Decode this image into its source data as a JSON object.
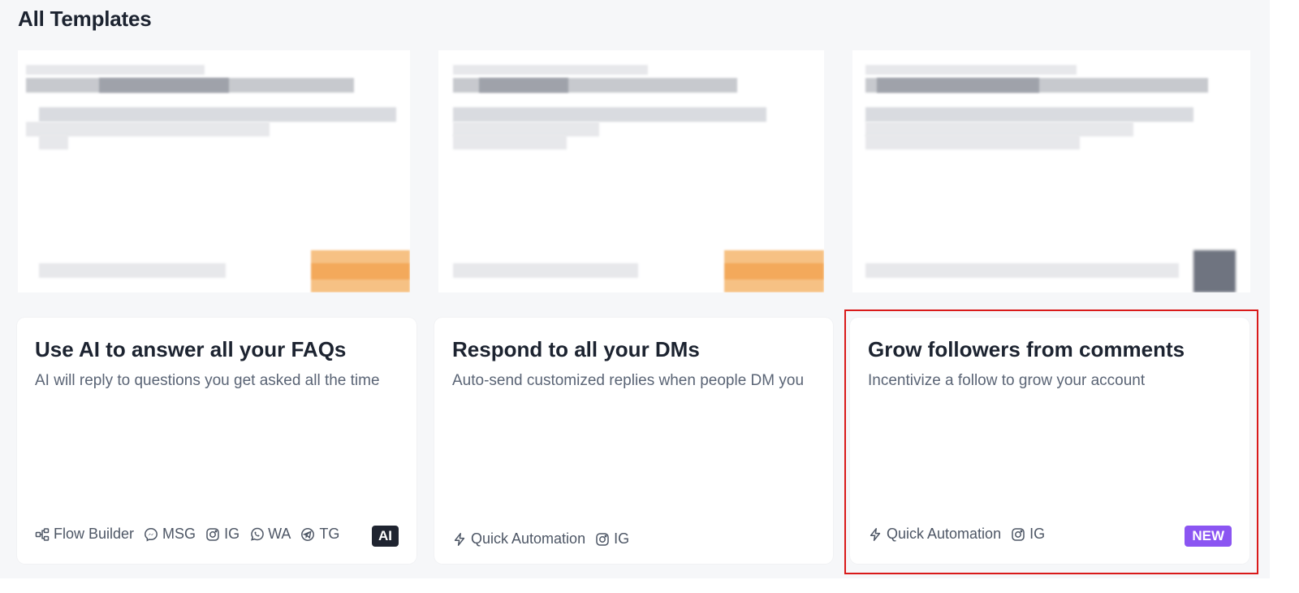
{
  "page": {
    "title": "All Templates"
  },
  "templates": [
    {
      "title": "Use AI to answer all your FAQs",
      "description": "AI will reply to questions you get asked all the time",
      "meta": [
        {
          "icon": "flow-builder-icon",
          "label": "Flow Builder"
        },
        {
          "icon": "messenger-icon",
          "label": "MSG"
        },
        {
          "icon": "instagram-icon",
          "label": "IG"
        },
        {
          "icon": "whatsapp-icon",
          "label": "WA"
        },
        {
          "icon": "telegram-icon",
          "label": "TG"
        }
      ],
      "tag": "AI"
    },
    {
      "title": "Respond to all your DMs",
      "description": "Auto-send customized replies when people DM you",
      "meta": [
        {
          "icon": "lightning-icon",
          "label": "Quick Automation"
        },
        {
          "icon": "instagram-icon",
          "label": "IG"
        }
      ],
      "tag": ""
    },
    {
      "title": "Grow followers from comments",
      "description": "Incentivize a follow to grow your account",
      "meta": [
        {
          "icon": "lightning-icon",
          "label": "Quick Automation"
        },
        {
          "icon": "instagram-icon",
          "label": "IG"
        }
      ],
      "tag": "NEW"
    }
  ],
  "colors": {
    "background": "#f6f7f9",
    "card": "#ffffff",
    "title_text": "#1c2330",
    "body_text": "#5a6475",
    "ai_tag": "#1f2430",
    "new_tag": "#8b55f2",
    "highlight": "#d91a1a",
    "preview_badge": "#f3a95b"
  }
}
